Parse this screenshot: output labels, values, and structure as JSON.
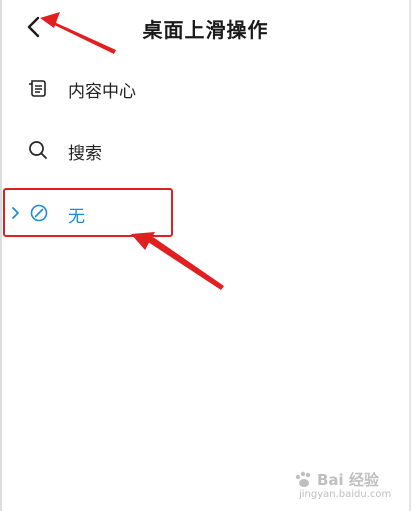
{
  "header": {
    "title": "桌面上滑操作"
  },
  "menu": {
    "items": [
      {
        "label": "内容中心",
        "icon": "content-center-icon",
        "selected": false
      },
      {
        "label": "搜索",
        "icon": "search-icon",
        "selected": false
      },
      {
        "label": "无",
        "icon": "disabled-icon",
        "selected": true
      }
    ]
  },
  "watermark": {
    "brand": "Bai 经验",
    "url": "jingyan.baidu.com"
  },
  "colors": {
    "accent": "#1e8bd6",
    "annotation": "#e02020",
    "text": "#1a1a1a"
  }
}
